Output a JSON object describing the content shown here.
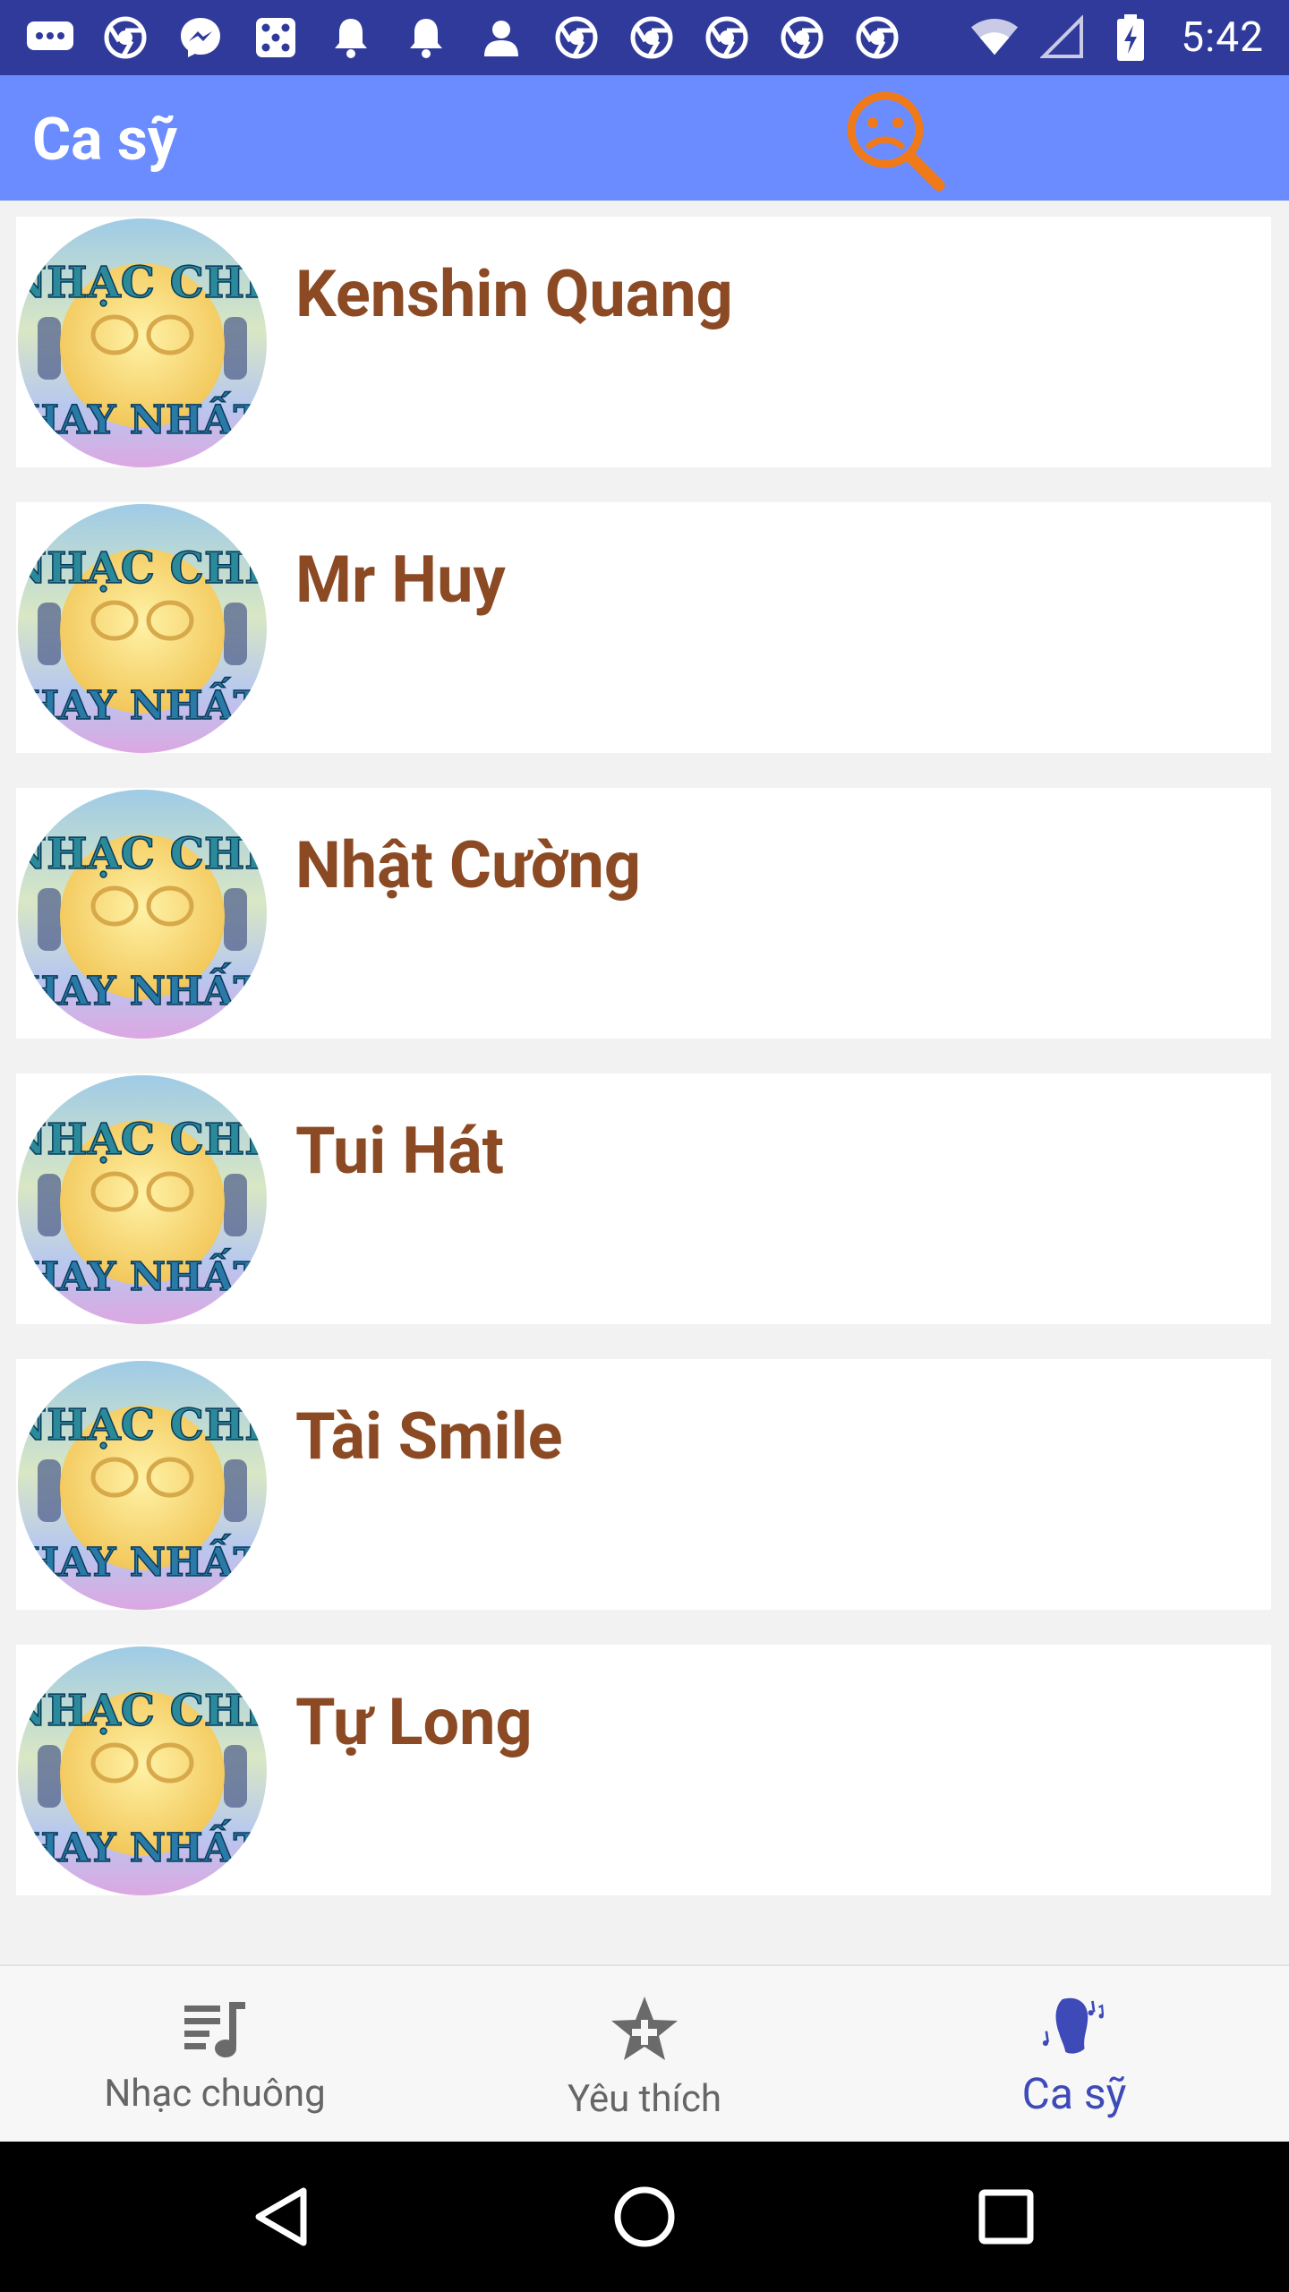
{
  "status_bar": {
    "time": "5:42",
    "left_icons": [
      "chat-bubble-icon",
      "chrome-icon",
      "messenger-icon",
      "dice-icon",
      "bell-icon",
      "bell-icon",
      "person-icon",
      "chrome-icon",
      "chrome-icon",
      "chrome-icon",
      "chrome-icon",
      "chrome-icon"
    ],
    "right_icons": [
      "wifi-icon",
      "signal-icon",
      "battery-charging-icon"
    ]
  },
  "app_bar": {
    "title": "Ca sỹ",
    "search_icon": "sad-face-search-icon",
    "accent": "#f07a1a",
    "background": "#6a8cff"
  },
  "singers": {
    "items": [
      {
        "name": "Kenshin Quang",
        "avatar_caption_top": "NHẠC CHẾ",
        "avatar_caption_bottom": "HAY NHẤT"
      },
      {
        "name": "Mr Huy",
        "avatar_caption_top": "NHẠC CHẾ",
        "avatar_caption_bottom": "HAY NHẤT"
      },
      {
        "name": "Nhật Cường",
        "avatar_caption_top": "NHẠC CHẾ",
        "avatar_caption_bottom": "HAY NHẤT"
      },
      {
        "name": "Tui Hát",
        "avatar_caption_top": "NHẠC CHẾ",
        "avatar_caption_bottom": "HAY NHẤT"
      },
      {
        "name": "Tài Smile",
        "avatar_caption_top": "NHẠC CHẾ",
        "avatar_caption_bottom": "HAY NHẤT"
      },
      {
        "name": "Tự Long",
        "avatar_caption_top": "NHẠC CHẾ",
        "avatar_caption_bottom": "HAY NHẤT"
      }
    ],
    "name_color": "#8b4a23"
  },
  "bottom_tabs": {
    "items": [
      {
        "label": "Nhạc chuông",
        "icon": "music-list-icon",
        "active": false
      },
      {
        "label": "Yêu thích",
        "icon": "star-plus-icon",
        "active": false
      },
      {
        "label": "Ca sỹ",
        "icon": "singer-head-icon",
        "active": true
      }
    ],
    "active_color": "#3d4ab8"
  },
  "nav_bar": {
    "buttons": [
      "back-icon",
      "home-icon",
      "recents-icon"
    ]
  }
}
